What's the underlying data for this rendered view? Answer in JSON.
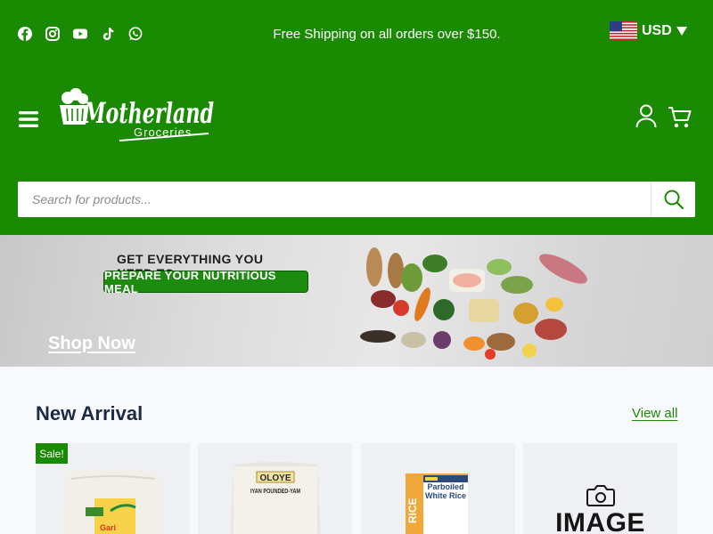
{
  "top_bar": {
    "social_icons": [
      "facebook-icon",
      "instagram-icon",
      "youtube-icon",
      "tiktok-icon",
      "whatsapp-icon"
    ],
    "promo": "Free Shipping on all orders over $150.",
    "currency": "USD"
  },
  "header": {
    "logo_text": "Motherland",
    "logo_subtext": "Groceries"
  },
  "search": {
    "placeholder": "Search for products..."
  },
  "banner": {
    "headline": "GET EVERYTHING YOU NEED TO",
    "pill": "PREPARE YOUR NUTRITIOUS MEAL",
    "cta": "Shop Now"
  },
  "new_arrival": {
    "title": "New Arrival",
    "view_all": "View all",
    "products": [
      {
        "badge": "Sale!",
        "pack_text": "Gari"
      },
      {
        "pack_brand": "OLOYE",
        "pack_text": "IYAN POUNDED-YAM"
      },
      {
        "pack_text": "Parboiled White Rice",
        "side_text": "RICE"
      },
      {
        "placeholder": "IMAGE"
      }
    ]
  },
  "colors": {
    "brand_green": "#198a02",
    "text_dark": "#1c2a44",
    "page_bg": "#f7f9fc"
  }
}
